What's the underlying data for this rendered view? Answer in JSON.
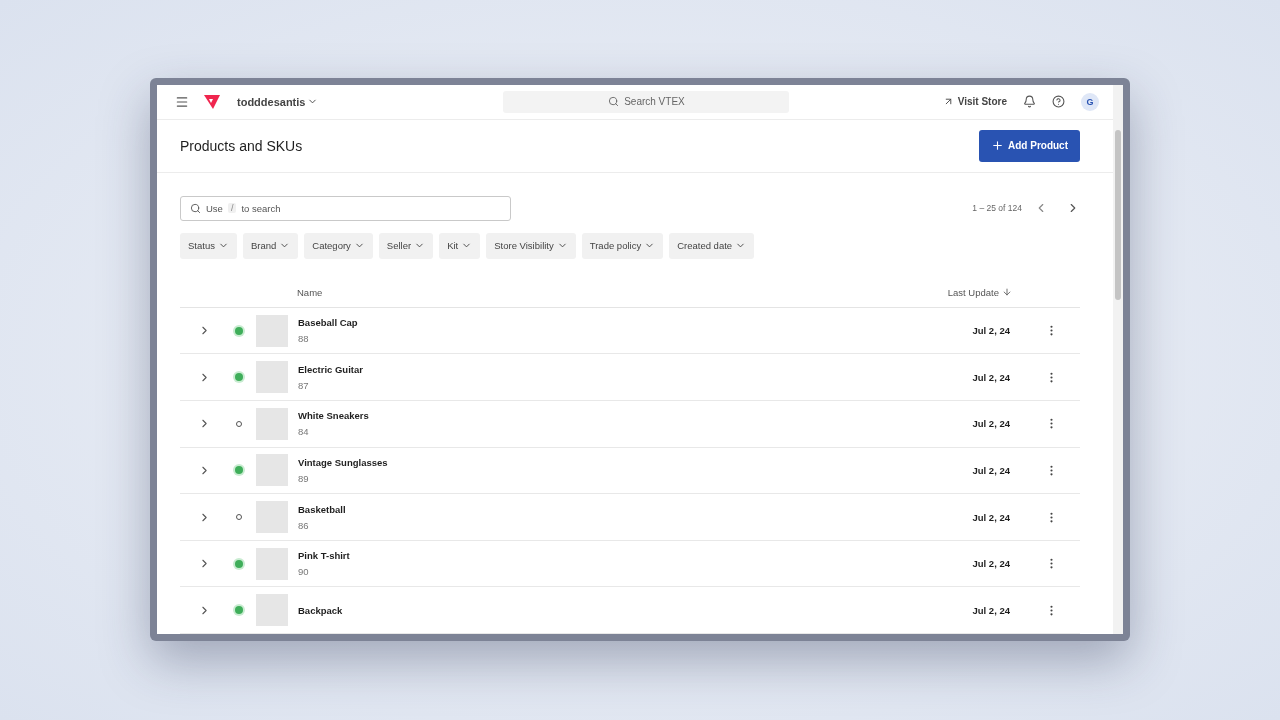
{
  "topbar": {
    "account": "todddesantis",
    "search_placeholder": "Search VTEX",
    "visit_store": "Visit Store",
    "avatar": "G"
  },
  "header": {
    "title": "Products and SKUs",
    "add_button": "Add Product"
  },
  "search": {
    "placeholder_before": "Use",
    "key": "/",
    "placeholder_after": "to search"
  },
  "pagination": {
    "range": "1 – 25 of 124"
  },
  "filters": [
    "Status",
    "Brand",
    "Category",
    "Seller",
    "Kit",
    "Store Visibility",
    "Trade policy",
    "Created date"
  ],
  "table": {
    "columns": [
      "Name",
      "Last Update"
    ],
    "rows": [
      {
        "name": "Baseball Cap",
        "sku": "88",
        "active": true,
        "date": "Jul 2, 24"
      },
      {
        "name": "Electric Guitar",
        "sku": "87",
        "active": true,
        "date": "Jul 2, 24"
      },
      {
        "name": "White Sneakers",
        "sku": "84",
        "active": false,
        "date": "Jul 2, 24"
      },
      {
        "name": "Vintage Sunglasses",
        "sku": "89",
        "active": true,
        "date": "Jul 2, 24"
      },
      {
        "name": "Basketball",
        "sku": "86",
        "active": false,
        "date": "Jul 2, 24"
      },
      {
        "name": "Pink T-shirt",
        "sku": "90",
        "active": true,
        "date": "Jul 2, 24"
      },
      {
        "name": "Backpack",
        "active": true,
        "date": "Jul 2, 24"
      }
    ]
  }
}
